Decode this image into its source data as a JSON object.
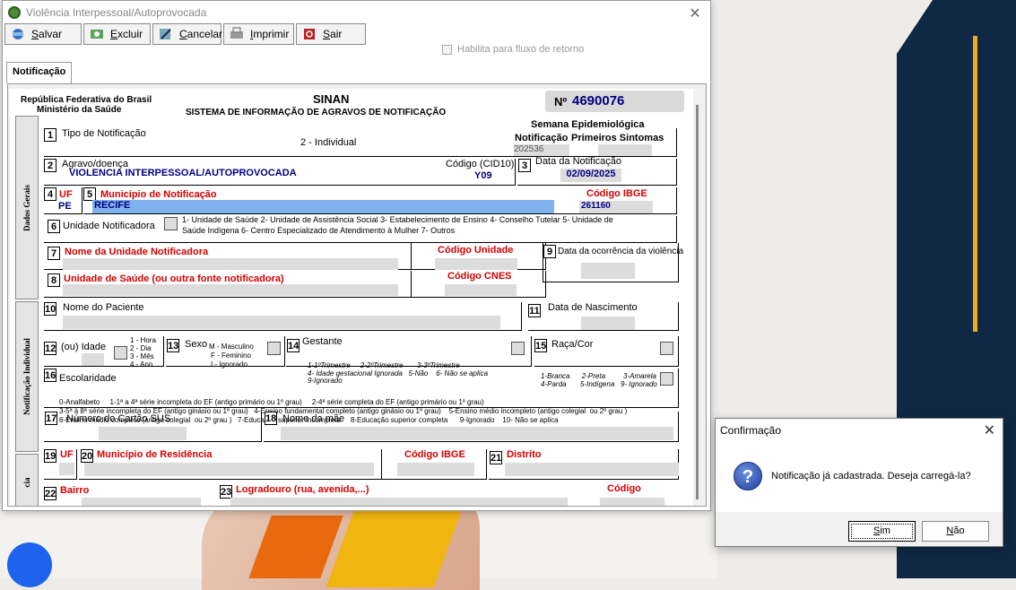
{
  "window": {
    "title": "Violência Interpessoal/Autoprovocada",
    "close": "✕"
  },
  "toolbar": {
    "salvar": "alvar",
    "salvar_u": "S",
    "excluir": "xcluir",
    "excluir_u": "E",
    "cancelar": "ancelar",
    "cancelar_u": "C",
    "imprimir": "mprimir",
    "imprimir_u": "I",
    "sair": "air",
    "sair_u": "S"
  },
  "options": {
    "fluxo_retorno": "Habilita para fluxo de retorno"
  },
  "tabs": {
    "notificacao": "Notificação"
  },
  "header": {
    "republica": "República Federativa do Brasil",
    "ministerio": "Ministério da Saúde",
    "sinan": "SINAN",
    "sistema": "SISTEMA DE INFORMAÇÃO  DE AGRAVOS DE NOTIFICAÇÃO",
    "numero_label": "Nº",
    "numero": "4690076",
    "semana_label": "Semana Epidemiológica",
    "notificacao_label": "Notificação",
    "primeiros_sintomas_label": "Primeiros Sintomas",
    "semana_notificacao": "202536"
  },
  "sections": {
    "dados_gerais": "Dados Gerais",
    "notificacao_individual": "Notificação Individual",
    "residencia": "cia"
  },
  "fields": {
    "f1_num": "1",
    "f1_label": "Tipo de Notificação",
    "f1_value": "2 - Individual",
    "f2_num": "2",
    "f2_label": "Agravo/doença",
    "f2_value": "VIOLENCIA INTERPESSOAL/AUTOPROVOCADA",
    "cid_label": "Código (CID10)",
    "cid_value": "Y09",
    "f3_num": "3",
    "f3_label": "Data da Notificação",
    "f3_value": "02/09/2025",
    "f4_num": "4",
    "f4_label": "UF",
    "f4_value": "PE",
    "f5_num": "5",
    "f5_label": "Município de Notificação",
    "f5_value": "RECIFE",
    "ibge_label": "Código IBGE",
    "ibge_value": "261160",
    "f6_num": "6",
    "f6_label": "Unidade Notificadora",
    "f6_opts_1": "1- Unidade de Saúde  2- Unidade de Assistência Social  3- Estabelecimento de Ensino  4- Conselho Tutelar  5- Unidade de",
    "f6_opts_2": "Saúde Indígena  6- Centro Especializado de Atendimento à Mulher   7- Outros",
    "f7_num": "7",
    "f7_label": "Nome da Unidade Notificadora",
    "cod_unidade_label": "Código Unidade",
    "f8_num": "8",
    "f8_label": "Unidade de Saúde (ou outra fonte notificadora)",
    "cod_cnes_label": "Código CNES",
    "f9_num": "9",
    "f9_label": "Data da ocorrência da violência",
    "f10_num": "10",
    "f10_label": "Nome do Paciente",
    "f11_num": "11",
    "f11_label": "Data de Nascimento",
    "f12_num": "12",
    "f12_label": "(ou) Idade",
    "idade_opts": [
      "1 - Hora",
      "2 - Dia",
      "3 - Mês",
      "4 - Ano"
    ],
    "f13_num": "13",
    "f13_label": "Sexo",
    "sexo_opts": [
      "M - Masculino",
      "F - Feminino",
      "I - Ignorado"
    ],
    "f14_num": "14",
    "f14_label": "Gestante",
    "gest_1": "1-1ºTrimestre     2-2ºTrimestre       3-3ºTrimestre",
    "gest_2": "4- Idade gestacional Ignorada   5-Não    6- Não se aplica",
    "gest_3": "9-Ignorado",
    "f15_num": "15",
    "f15_label": "Raça/Cor",
    "raca_1": "1-Branca      2-Preta         3-Amarela",
    "raca_2": "4-Parda       5-Indígena   9- Ignorado",
    "f16_num": "16",
    "f16_label": "Escolaridade",
    "esc_1": "0-Analfabeto     1-1ª a 4ª série incompleta do EF (antigo primário ou 1º grau)     2-4ª série completa do EF (antigo primário ou 1º grau)",
    "esc_2": "3-5ª à 8ª série incompleta do EF (antigo ginásio ou 1º grau)   4-Ensino fundamental completo (antigo ginásio ou 1º grau)    5-Ensino médio incompleto (antigo colegial  ou 2º grau )",
    "esc_3": "6-Ensino médio completo (antigo colegial  ou 2º grau )   7-Educação superior incompleta     8-Educação superior completa      9-Ignorado    10- Não se aplica",
    "f17_num": "17",
    "f17_label": "Número do Cartão SUS",
    "f18_num": "18",
    "f18_label": "Nome da mãe",
    "f19_num": "19",
    "f19_label": "UF",
    "f20_num": "20",
    "f20_label": "Município de Residência",
    "ibge2_label": "Código IBGE",
    "f21_num": "21",
    "f21_label": "Distrito",
    "f22_num": "22",
    "f22_label": "Bairro",
    "f23_num": "23",
    "f23_label": "Logradouro (rua, avenida,...)",
    "codigo_label": "Código"
  },
  "dialog": {
    "title": "Confirmação",
    "close": "✕",
    "message": "Notificação já cadastrada. Deseja carregá-la?",
    "yes_u": "S",
    "yes": "im",
    "no_u": "N",
    "no": "ão"
  }
}
